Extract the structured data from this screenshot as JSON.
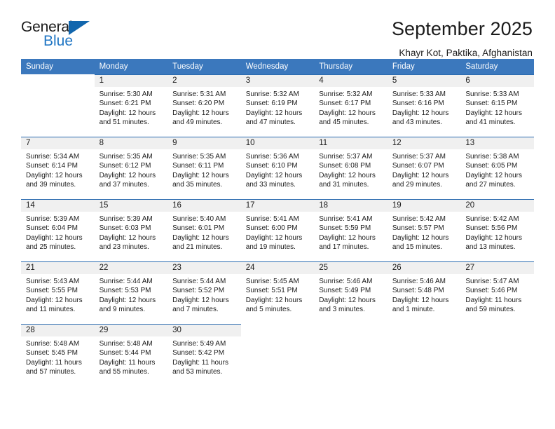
{
  "brand": {
    "name_top": "General",
    "name_bottom": "Blue",
    "accent_color": "#2076c4",
    "triangle_color": "#1266ad"
  },
  "header": {
    "title": "September 2025",
    "subtitle": "Khayr Kot, Paktika, Afghanistan"
  },
  "calendar": {
    "header_bg": "#3b78bd",
    "daynum_bg": "#f0f0f0",
    "row_rule_color": "#2a6bb0",
    "weekdays": [
      "Sunday",
      "Monday",
      "Tuesday",
      "Wednesday",
      "Thursday",
      "Friday",
      "Saturday"
    ],
    "weeks": [
      [
        {
          "day": "",
          "sunrise": "",
          "sunset": "",
          "daylight1": "",
          "daylight2": ""
        },
        {
          "day": "1",
          "sunrise": "Sunrise: 5:30 AM",
          "sunset": "Sunset: 6:21 PM",
          "daylight1": "Daylight: 12 hours",
          "daylight2": "and 51 minutes."
        },
        {
          "day": "2",
          "sunrise": "Sunrise: 5:31 AM",
          "sunset": "Sunset: 6:20 PM",
          "daylight1": "Daylight: 12 hours",
          "daylight2": "and 49 minutes."
        },
        {
          "day": "3",
          "sunrise": "Sunrise: 5:32 AM",
          "sunset": "Sunset: 6:19 PM",
          "daylight1": "Daylight: 12 hours",
          "daylight2": "and 47 minutes."
        },
        {
          "day": "4",
          "sunrise": "Sunrise: 5:32 AM",
          "sunset": "Sunset: 6:17 PM",
          "daylight1": "Daylight: 12 hours",
          "daylight2": "and 45 minutes."
        },
        {
          "day": "5",
          "sunrise": "Sunrise: 5:33 AM",
          "sunset": "Sunset: 6:16 PM",
          "daylight1": "Daylight: 12 hours",
          "daylight2": "and 43 minutes."
        },
        {
          "day": "6",
          "sunrise": "Sunrise: 5:33 AM",
          "sunset": "Sunset: 6:15 PM",
          "daylight1": "Daylight: 12 hours",
          "daylight2": "and 41 minutes."
        }
      ],
      [
        {
          "day": "7",
          "sunrise": "Sunrise: 5:34 AM",
          "sunset": "Sunset: 6:14 PM",
          "daylight1": "Daylight: 12 hours",
          "daylight2": "and 39 minutes."
        },
        {
          "day": "8",
          "sunrise": "Sunrise: 5:35 AM",
          "sunset": "Sunset: 6:12 PM",
          "daylight1": "Daylight: 12 hours",
          "daylight2": "and 37 minutes."
        },
        {
          "day": "9",
          "sunrise": "Sunrise: 5:35 AM",
          "sunset": "Sunset: 6:11 PM",
          "daylight1": "Daylight: 12 hours",
          "daylight2": "and 35 minutes."
        },
        {
          "day": "10",
          "sunrise": "Sunrise: 5:36 AM",
          "sunset": "Sunset: 6:10 PM",
          "daylight1": "Daylight: 12 hours",
          "daylight2": "and 33 minutes."
        },
        {
          "day": "11",
          "sunrise": "Sunrise: 5:37 AM",
          "sunset": "Sunset: 6:08 PM",
          "daylight1": "Daylight: 12 hours",
          "daylight2": "and 31 minutes."
        },
        {
          "day": "12",
          "sunrise": "Sunrise: 5:37 AM",
          "sunset": "Sunset: 6:07 PM",
          "daylight1": "Daylight: 12 hours",
          "daylight2": "and 29 minutes."
        },
        {
          "day": "13",
          "sunrise": "Sunrise: 5:38 AM",
          "sunset": "Sunset: 6:05 PM",
          "daylight1": "Daylight: 12 hours",
          "daylight2": "and 27 minutes."
        }
      ],
      [
        {
          "day": "14",
          "sunrise": "Sunrise: 5:39 AM",
          "sunset": "Sunset: 6:04 PM",
          "daylight1": "Daylight: 12 hours",
          "daylight2": "and 25 minutes."
        },
        {
          "day": "15",
          "sunrise": "Sunrise: 5:39 AM",
          "sunset": "Sunset: 6:03 PM",
          "daylight1": "Daylight: 12 hours",
          "daylight2": "and 23 minutes."
        },
        {
          "day": "16",
          "sunrise": "Sunrise: 5:40 AM",
          "sunset": "Sunset: 6:01 PM",
          "daylight1": "Daylight: 12 hours",
          "daylight2": "and 21 minutes."
        },
        {
          "day": "17",
          "sunrise": "Sunrise: 5:41 AM",
          "sunset": "Sunset: 6:00 PM",
          "daylight1": "Daylight: 12 hours",
          "daylight2": "and 19 minutes."
        },
        {
          "day": "18",
          "sunrise": "Sunrise: 5:41 AM",
          "sunset": "Sunset: 5:59 PM",
          "daylight1": "Daylight: 12 hours",
          "daylight2": "and 17 minutes."
        },
        {
          "day": "19",
          "sunrise": "Sunrise: 5:42 AM",
          "sunset": "Sunset: 5:57 PM",
          "daylight1": "Daylight: 12 hours",
          "daylight2": "and 15 minutes."
        },
        {
          "day": "20",
          "sunrise": "Sunrise: 5:42 AM",
          "sunset": "Sunset: 5:56 PM",
          "daylight1": "Daylight: 12 hours",
          "daylight2": "and 13 minutes."
        }
      ],
      [
        {
          "day": "21",
          "sunrise": "Sunrise: 5:43 AM",
          "sunset": "Sunset: 5:55 PM",
          "daylight1": "Daylight: 12 hours",
          "daylight2": "and 11 minutes."
        },
        {
          "day": "22",
          "sunrise": "Sunrise: 5:44 AM",
          "sunset": "Sunset: 5:53 PM",
          "daylight1": "Daylight: 12 hours",
          "daylight2": "and 9 minutes."
        },
        {
          "day": "23",
          "sunrise": "Sunrise: 5:44 AM",
          "sunset": "Sunset: 5:52 PM",
          "daylight1": "Daylight: 12 hours",
          "daylight2": "and 7 minutes."
        },
        {
          "day": "24",
          "sunrise": "Sunrise: 5:45 AM",
          "sunset": "Sunset: 5:51 PM",
          "daylight1": "Daylight: 12 hours",
          "daylight2": "and 5 minutes."
        },
        {
          "day": "25",
          "sunrise": "Sunrise: 5:46 AM",
          "sunset": "Sunset: 5:49 PM",
          "daylight1": "Daylight: 12 hours",
          "daylight2": "and 3 minutes."
        },
        {
          "day": "26",
          "sunrise": "Sunrise: 5:46 AM",
          "sunset": "Sunset: 5:48 PM",
          "daylight1": "Daylight: 12 hours",
          "daylight2": "and 1 minute."
        },
        {
          "day": "27",
          "sunrise": "Sunrise: 5:47 AM",
          "sunset": "Sunset: 5:46 PM",
          "daylight1": "Daylight: 11 hours",
          "daylight2": "and 59 minutes."
        }
      ],
      [
        {
          "day": "28",
          "sunrise": "Sunrise: 5:48 AM",
          "sunset": "Sunset: 5:45 PM",
          "daylight1": "Daylight: 11 hours",
          "daylight2": "and 57 minutes."
        },
        {
          "day": "29",
          "sunrise": "Sunrise: 5:48 AM",
          "sunset": "Sunset: 5:44 PM",
          "daylight1": "Daylight: 11 hours",
          "daylight2": "and 55 minutes."
        },
        {
          "day": "30",
          "sunrise": "Sunrise: 5:49 AM",
          "sunset": "Sunset: 5:42 PM",
          "daylight1": "Daylight: 11 hours",
          "daylight2": "and 53 minutes."
        },
        {
          "day": "",
          "sunrise": "",
          "sunset": "",
          "daylight1": "",
          "daylight2": ""
        },
        {
          "day": "",
          "sunrise": "",
          "sunset": "",
          "daylight1": "",
          "daylight2": ""
        },
        {
          "day": "",
          "sunrise": "",
          "sunset": "",
          "daylight1": "",
          "daylight2": ""
        },
        {
          "day": "",
          "sunrise": "",
          "sunset": "",
          "daylight1": "",
          "daylight2": ""
        }
      ]
    ]
  }
}
